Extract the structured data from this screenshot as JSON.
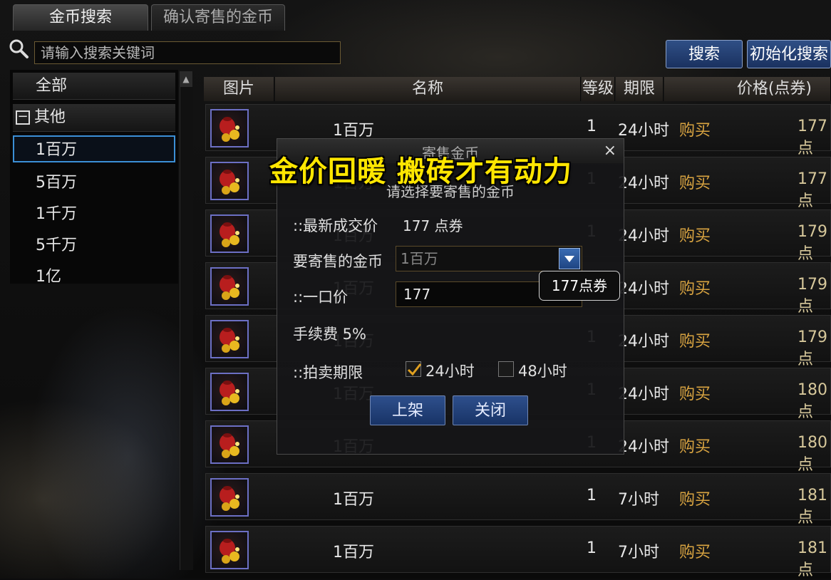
{
  "tabs": {
    "search_gold": "金币搜索",
    "confirm_consigned": "确认寄售的金币"
  },
  "search": {
    "placeholder": "请输入搜索关键词",
    "search_button": "搜索",
    "reset_button": "初始化搜索"
  },
  "categories": {
    "all": "全部",
    "group_toggle": "−",
    "other": "其他",
    "items": [
      "1百万",
      "5百万",
      "1千万",
      "5千万",
      "1亿"
    ]
  },
  "table": {
    "headers": {
      "image": "图片",
      "name": "名称",
      "level": "等级",
      "period": "期限",
      "price": "价格(点券)"
    },
    "rows": [
      {
        "name": "1百万",
        "level": "1",
        "period": "24小时",
        "action": "购买",
        "price": "177 点"
      },
      {
        "name": "1百万",
        "level": "1",
        "period": "24小时",
        "action": "购买",
        "price": "177 点"
      },
      {
        "name": "1百万",
        "level": "1",
        "period": "24小时",
        "action": "购买",
        "price": "179 点"
      },
      {
        "name": "1百万",
        "level": "1",
        "period": "24小时",
        "action": "购买",
        "price": "179 点"
      },
      {
        "name": "1百万",
        "level": "1",
        "period": "24小时",
        "action": "购买",
        "price": "179 点"
      },
      {
        "name": "1百万",
        "level": "1",
        "period": "24小时",
        "action": "购买",
        "price": "180 点"
      },
      {
        "name": "1百万",
        "level": "1",
        "period": "24小时",
        "action": "购买",
        "price": "180 点"
      },
      {
        "name": "1百万",
        "level": "1",
        "period": "7小时",
        "action": "购买",
        "price": "181 点"
      },
      {
        "name": "1百万",
        "level": "1",
        "period": "7小时",
        "action": "购买",
        "price": "181 点"
      }
    ]
  },
  "modal": {
    "title": "寄售金币",
    "close": "×",
    "subtitle": "请选择要寄售的金币",
    "latest_price_label": "::最新成交价",
    "latest_price_value": "177 点券",
    "gold_label": "要寄售的金币",
    "gold_selected": "1百万",
    "buyout_label": "::一口价",
    "buyout_value": "177",
    "tooltip": "177点券",
    "fee_label": "手续费 5%",
    "period_label": "::拍卖期限",
    "option_24": "24小时",
    "option_48": "48小时",
    "list_button": "上架",
    "close_button": "关闭"
  },
  "caption": "金价回暖 搬砖才有动力",
  "colors": {
    "caption": "#ffe600",
    "buy_link": "#d9a441",
    "selection_border": "#3b8fd6",
    "button_blue": "#2e4f8c"
  }
}
